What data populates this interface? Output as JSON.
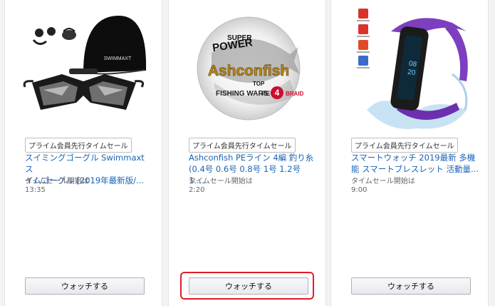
{
  "accent_color": "#1a64b6",
  "highlight_color": "#e11d2a",
  "products": [
    {
      "badge": "プライム会員先行タイムセール",
      "title_line1": "スイミングゴーグル Swimmaxt ス",
      "title_line2": "イムゴーグル [2019年最新版/...",
      "meta_label": "タイムセール開始は",
      "meta_time": "13:35",
      "button": "ウォッチする",
      "image_brand": "SWIMMAXT",
      "icons": "goggles-cap-earplug-icon"
    },
    {
      "badge": "プライム会員先行タイムセール",
      "title_line1": "Ashconfish PEライン 4編 釣り糸",
      "title_line2": "(0.4号 0.6号 0.8号 1号 1.2号 1....",
      "meta_label": "タイムセール開始は",
      "meta_time": "2:20",
      "button": "ウォッチする",
      "image_label_top": "SUPER",
      "image_label_power": "POWER",
      "image_label_brand": "Ashconfish",
      "image_label_top2": "TOP",
      "image_label_wars": "FISHING WARS",
      "image_label_pe": "PE",
      "image_label_num": "4",
      "image_label_braid": "BRAID",
      "icons": "fishing-line-spool-icon"
    },
    {
      "badge": "プライム会員先行タイムセール",
      "title_line1": "スマートウォッチ 2019最新 多機",
      "title_line2": "能 スマートブレスレット 活動量...",
      "meta_label": "タイムセール開始は",
      "meta_time": "9:00",
      "button": "ウォッチする",
      "icons": "smartwatch-band-icon"
    }
  ]
}
